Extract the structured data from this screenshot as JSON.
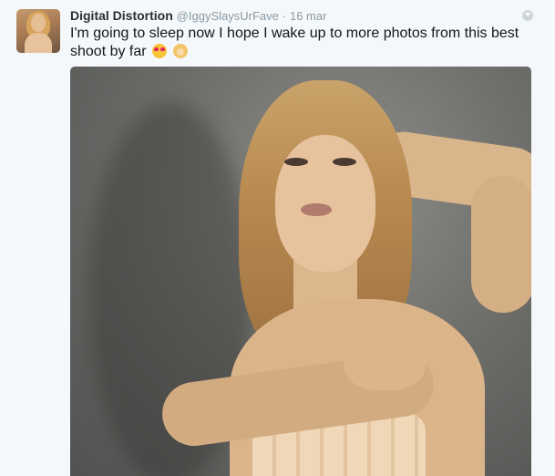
{
  "tweet": {
    "display_name": "Digital Distortion",
    "screen_name": "@IggySlaysUrFave",
    "separator": "·",
    "timestamp": "16 mar",
    "text": "I'm going to sleep now I hope I wake up to more photos from this best shoot by far",
    "emojis": [
      "heart-eyes-emoji",
      "person-blond-emoji"
    ]
  },
  "icons": {
    "menu": "caret-down-icon"
  },
  "colors": {
    "background": "#f5f8fa",
    "name": "#292f33",
    "meta": "#8899a6",
    "text": "#14171a"
  }
}
